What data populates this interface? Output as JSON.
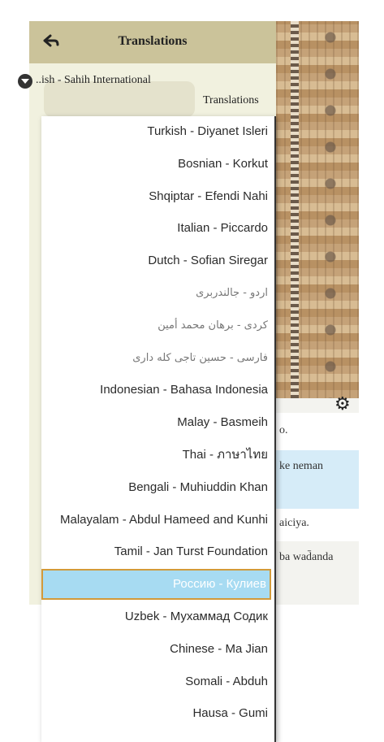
{
  "panel": {
    "title": "Translations",
    "selected_translation": "..ish - Sahih International",
    "tab_label": "Translations"
  },
  "background": {
    "row1": "o.",
    "row2": "ke neman",
    "row3": "aiciya.",
    "row4": "ba wad̄anda"
  },
  "dropdown": {
    "options": [
      "Turkish - Diyanet Isleri",
      "Bosnian - Korkut",
      "Shqiptar - Efendi Nahi",
      "Italian - Piccardo",
      "Dutch - Sofian Siregar",
      "اردو - جالندربرى",
      "كردى - برهان محمد أمين",
      "فارسى - حسين تاجى كله دارى",
      "Indonesian - Bahasa Indonesia",
      "Malay - Basmeih",
      "Thai - ภาษาไทย",
      "Bengali - Muhiuddin Khan",
      "Malayalam - Abdul Hameed and Kunhi",
      "Tamil - Jan Turst Foundation",
      "Россию - Кулиев",
      "Uzbek - Мухаммад Содик",
      "Chinese - Ma Jian",
      "Somali - Abduh",
      "Hausa - Gumi"
    ],
    "selected": "Россию - Кулиев"
  },
  "icons": [
    "back-arrow-icon",
    "dropdown-arrow-icon",
    "gear-icon"
  ]
}
